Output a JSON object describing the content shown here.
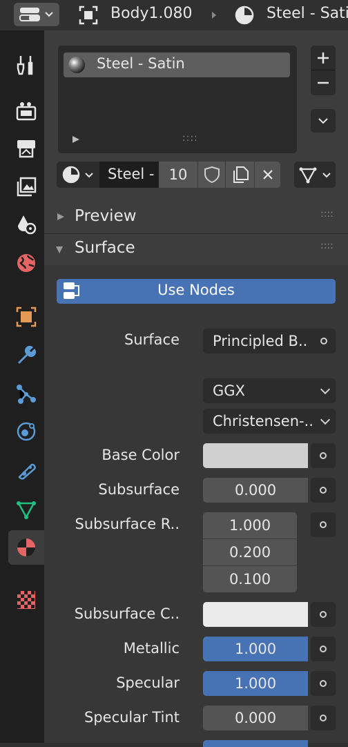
{
  "header": {
    "object_name": "Body1.080",
    "material_name": "Steel - Sati"
  },
  "material_slots": {
    "items": [
      "Steel - Satin"
    ],
    "add_icon": "plus-icon",
    "remove_icon": "minus-icon",
    "grip": "::::"
  },
  "datablock": {
    "name": "Steel -",
    "users": "10"
  },
  "panels": {
    "preview": "Preview",
    "surface": "Surface"
  },
  "use_nodes_label": "Use Nodes",
  "surface": {
    "surface_label": "Surface",
    "surface_value": "Principled B..",
    "distribution": "GGX",
    "subsurface_method": "Christensen-..",
    "base_color_label": "Base Color",
    "base_color_hex": "#d0d0d0",
    "subsurface_label": "Subsurface",
    "subsurface_value": "0.000",
    "subsurface_radius_label": "Subsurface R..",
    "subsurface_radius": [
      "1.000",
      "0.200",
      "0.100"
    ],
    "subsurface_color_label": "Subsurface C..",
    "subsurface_color_hex": "#ebebeb",
    "metallic_label": "Metallic",
    "metallic_value": "1.000",
    "specular_label": "Specular",
    "specular_value": "1.000",
    "specular_tint_label": "Specular Tint",
    "specular_tint_value": "0.000"
  },
  "colors": {
    "accent_blue": "#4772b3",
    "material_active_red": "#e56565"
  }
}
